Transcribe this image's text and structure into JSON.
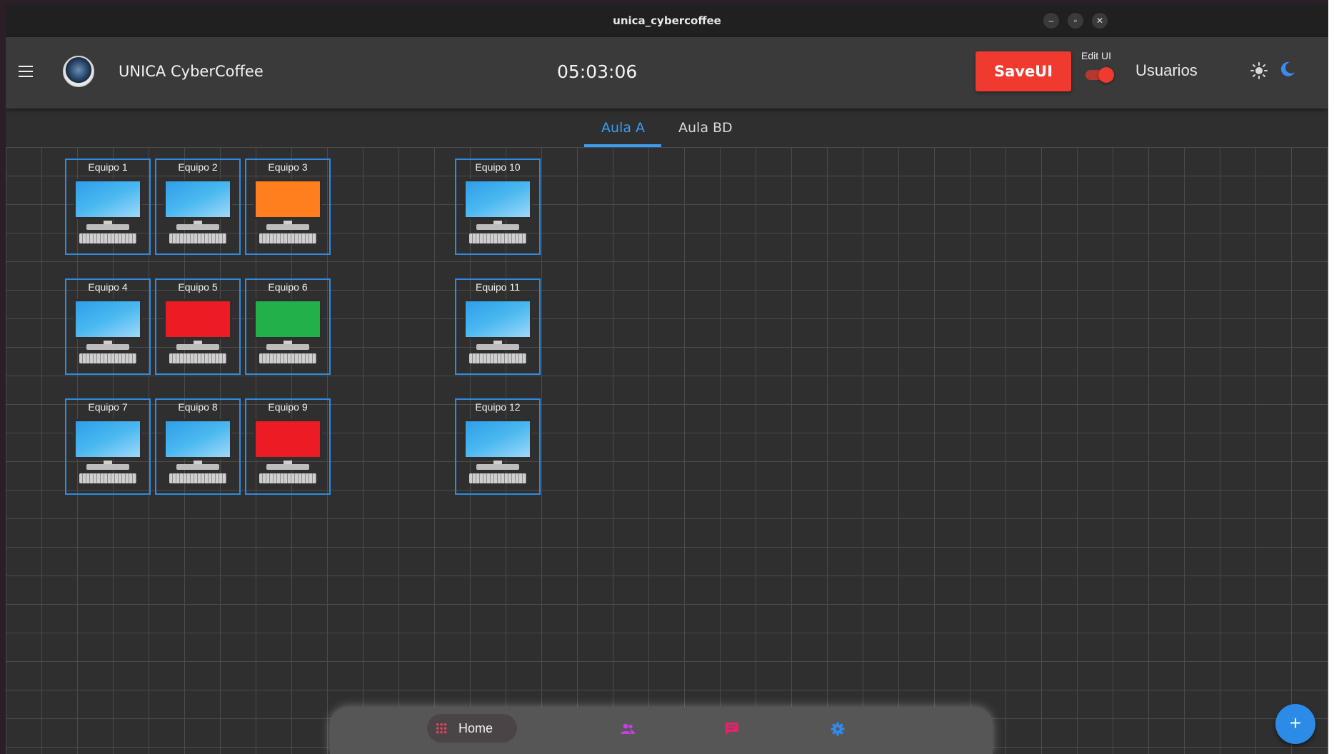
{
  "window": {
    "title": "unica_cybercoffee",
    "minimize": "–",
    "maximize": "▫",
    "close": "✕"
  },
  "appbar": {
    "title": "UNICA CyberCoffee",
    "clock": "05:03:06",
    "save_label": "SaveUI",
    "edit_ui_label": "Edit UI",
    "edit_ui_on": true,
    "users_label": "Usuarios"
  },
  "tabs": [
    {
      "label": "Aula A",
      "active": true
    },
    {
      "label": "Aula BD",
      "active": false
    }
  ],
  "stations": [
    {
      "label": "Equipo 1",
      "status": "blue"
    },
    {
      "label": "Equipo 2",
      "status": "blue"
    },
    {
      "label": "Equipo 3",
      "status": "orange"
    },
    {
      "label": "Equipo 10",
      "status": "blue"
    },
    {
      "label": "Equipo 4",
      "status": "blue"
    },
    {
      "label": "Equipo 5",
      "status": "red"
    },
    {
      "label": "Equipo 6",
      "status": "green"
    },
    {
      "label": "Equipo 11",
      "status": "blue"
    },
    {
      "label": "Equipo 7",
      "status": "blue"
    },
    {
      "label": "Equipo 8",
      "status": "blue"
    },
    {
      "label": "Equipo 9",
      "status": "red"
    },
    {
      "label": "Equipo 12",
      "status": "blue"
    }
  ],
  "navbar": {
    "home_label": "Home"
  },
  "fab": {
    "label": "+"
  },
  "colors": {
    "accent": "#3b9df2",
    "save": "#f0392f",
    "station_border": "#2e8be0"
  }
}
